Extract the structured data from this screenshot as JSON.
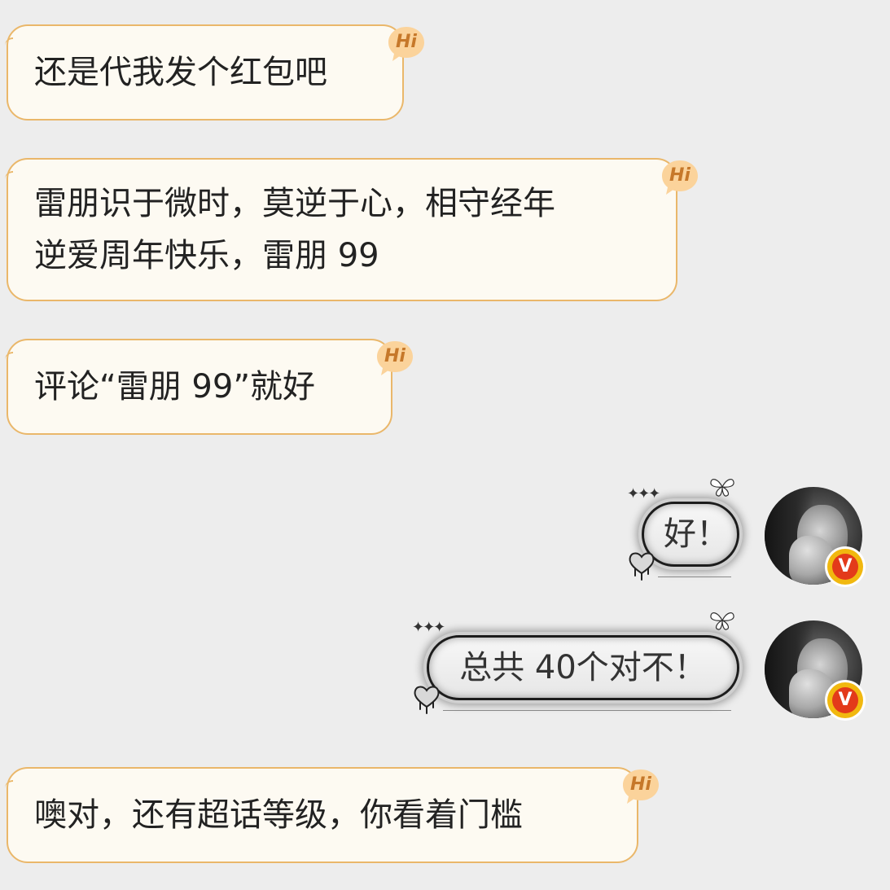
{
  "messages": {
    "m1": {
      "line1": "还是代我发个红包吧",
      "badge": "Hi"
    },
    "m2": {
      "line1": "雷朋识于微时，莫逆于心，相守经年",
      "line2": "逆爱周年快乐，雷朋 99",
      "badge": "Hi"
    },
    "m3": {
      "line1": "评论“雷朋 99”就好",
      "badge": "Hi"
    },
    "m4": {
      "text": "好！"
    },
    "m5": {
      "text": "总共 40个对不！"
    },
    "m6": {
      "line1": "噢对，还有超话等级，你看着门槛",
      "badge": "Hi"
    }
  },
  "verified": {
    "label": "V"
  },
  "icons": {
    "hi_badge": "hi-speech-bubble-icon",
    "verified": "verified-v-icon",
    "sparkle": "sparkle-icon",
    "butterfly": "butterfly-icon",
    "heart": "melting-heart-icon"
  },
  "colors": {
    "background": "#ededed",
    "incoming_bubble": "#fdfaf2",
    "incoming_border": "#eab76a",
    "hi_badge": "#fbd39b",
    "hi_text": "#c6782a",
    "verified_outer": "#f1b80f",
    "verified_inner": "#e33a1a"
  }
}
